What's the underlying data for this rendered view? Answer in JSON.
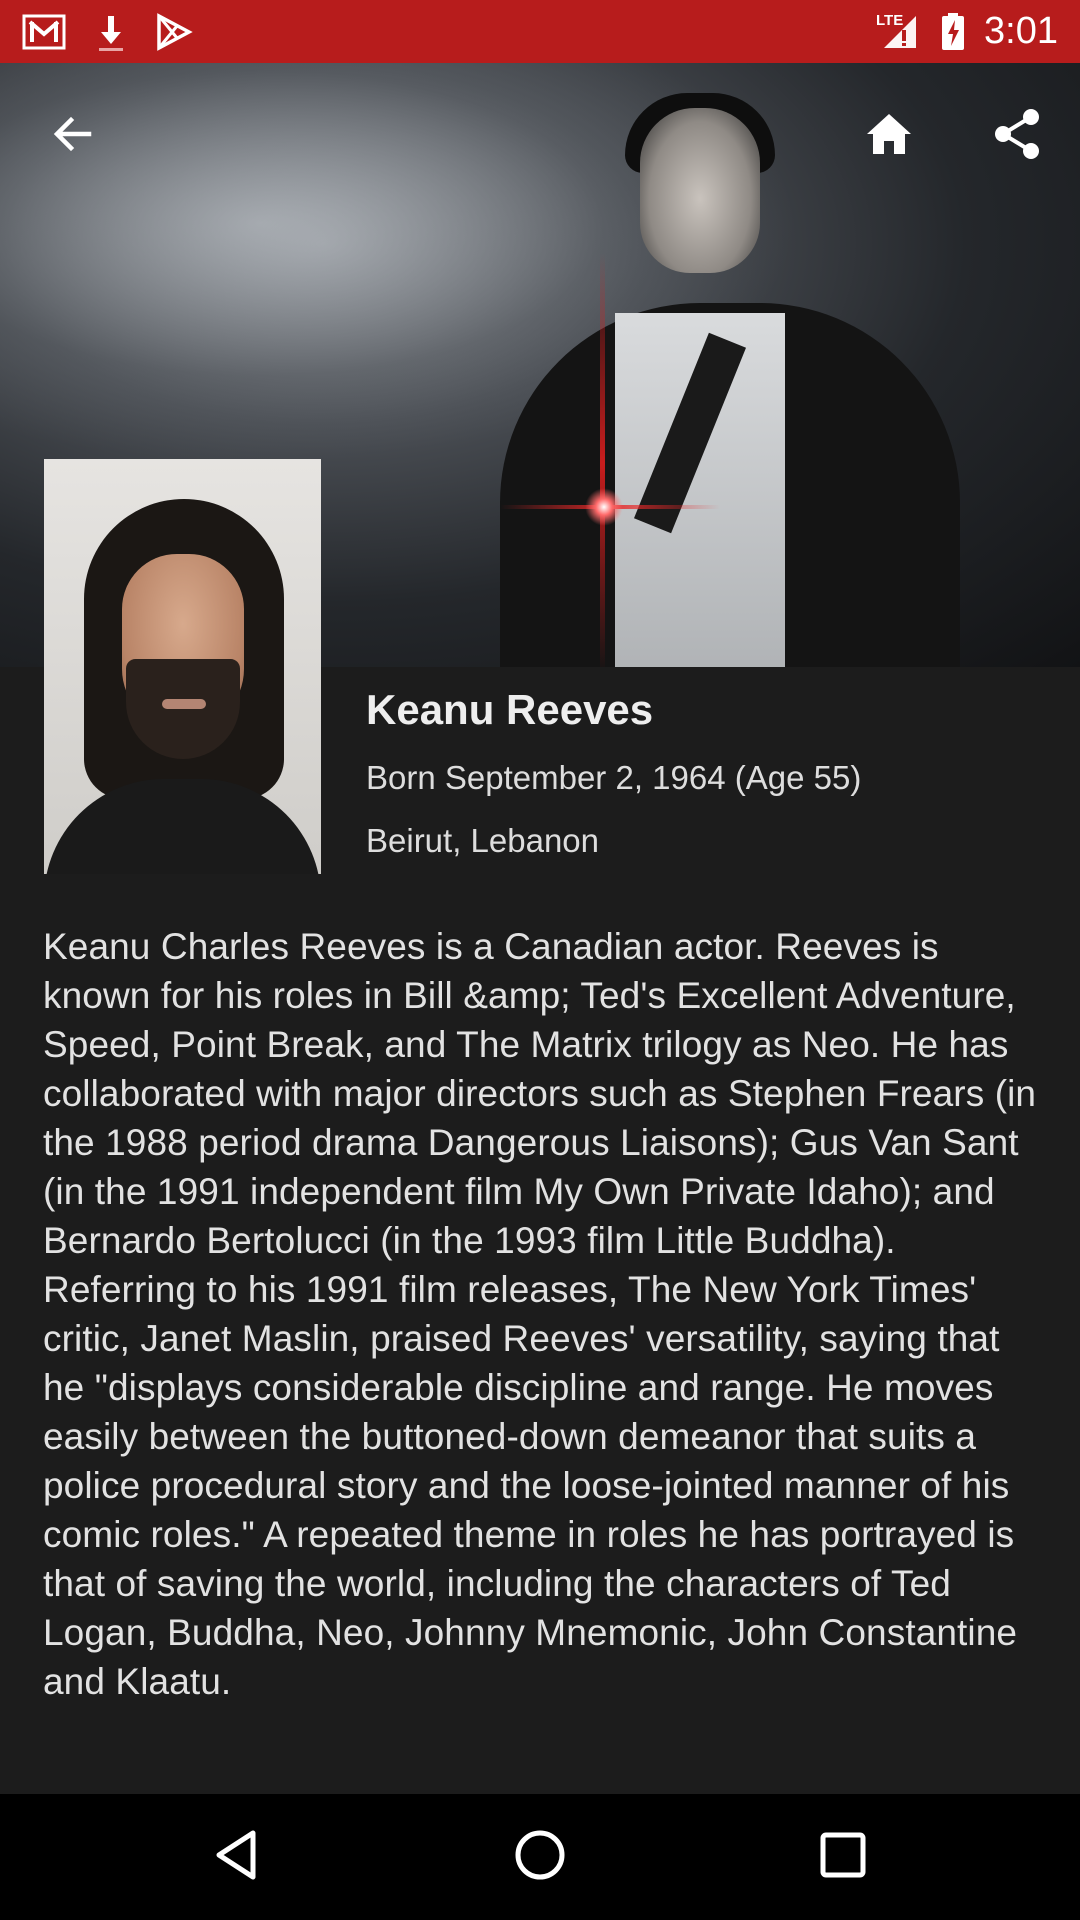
{
  "status_bar": {
    "time": "3:01",
    "network": "LTE",
    "icons": [
      "gmail-icon",
      "download-icon",
      "play-store-icon",
      "signal-icon",
      "battery-charging-icon"
    ],
    "color": "#b71c1c"
  },
  "toolbar": {
    "icons": [
      "back-arrow-icon",
      "home-icon",
      "share-icon"
    ]
  },
  "person": {
    "name": "Keanu Reeves",
    "born": "Born September 2, 1964 (Age 55)",
    "place": "Beirut, Lebanon",
    "biography": "Keanu Charles Reeves is a Canadian actor. Reeves is known for his roles in Bill &amp; Ted's Excellent Adventure, Speed, Point Break, and The Matrix trilogy as Neo. He has collaborated with major directors such as Stephen Frears (in the 1988 period drama Dangerous Liaisons); Gus Van Sant (in the 1991 independent film My Own Private Idaho); and Bernardo Bertolucci (in the 1993 film Little Buddha). Referring to his 1991 film releases, The New York Times' critic, Janet Maslin, praised Reeves' versatility, saying that he \"displays considerable discipline and range. He moves easily between the buttoned-down demeanor that suits a police procedural story and the loose-jointed manner of his comic roles.\" A repeated theme in roles he has portrayed is that of saving the world, including the characters of Ted Logan, Buddha, Neo, Johnny Mnemonic, John Constantine and Klaatu."
  },
  "nav_bar": {
    "icons": [
      "back-triangle-icon",
      "home-circle-icon",
      "recents-square-icon"
    ]
  },
  "colors": {
    "background": "#1c1c1c",
    "text": "#e2e2e2"
  }
}
